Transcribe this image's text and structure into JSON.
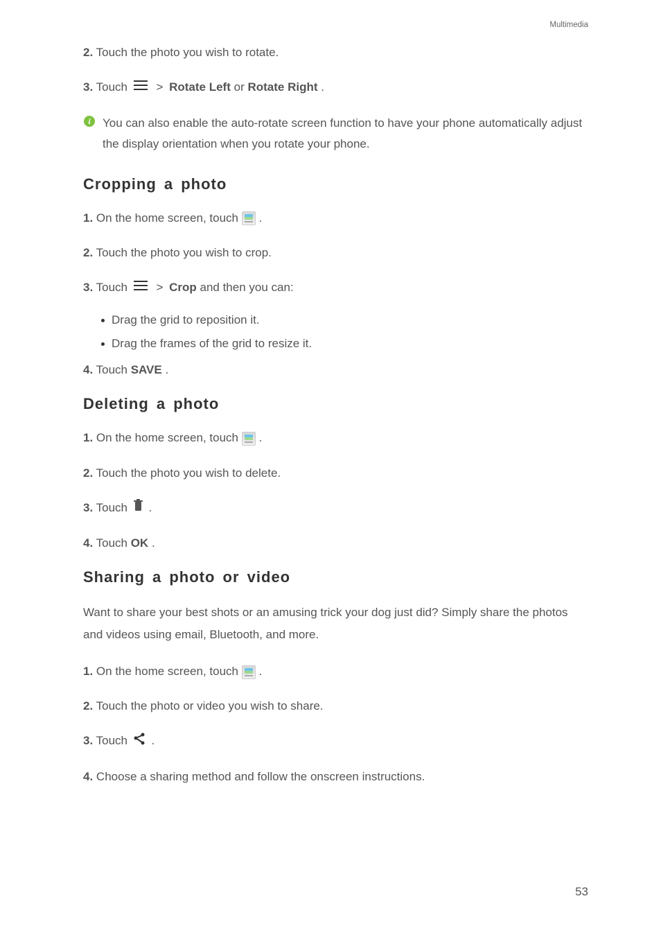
{
  "header": "Multimedia",
  "intro_steps": {
    "step2": {
      "num": "2.",
      "text": "Touch the photo you wish to rotate."
    },
    "step3": {
      "num": "3.",
      "prefix": "Touch ",
      "gt": " > ",
      "opt1": "Rotate Left",
      "or": " or ",
      "opt2": "Rotate Right",
      "period": "."
    }
  },
  "note": "You can also enable the auto-rotate screen function to have your phone automatically adjust the display orientation when you rotate your phone.",
  "cropping": {
    "heading": "Cropping a photo",
    "step1": {
      "num": "1.",
      "prefix": "On the home screen, touch ",
      "suffix": "."
    },
    "step2": {
      "num": "2.",
      "text": "Touch the photo you wish to crop."
    },
    "step3": {
      "num": "3.",
      "prefix": "Touch ",
      "gt": " > ",
      "crop": "Crop",
      "suffix": " and then you can:"
    },
    "bullet1": "Drag the grid to reposition it.",
    "bullet2": "Drag the frames of the grid to resize it.",
    "step4": {
      "num": "4.",
      "prefix": "Touch ",
      "save": "SAVE",
      "period": "."
    }
  },
  "deleting": {
    "heading": "Deleting a photo",
    "step1": {
      "num": "1.",
      "prefix": "On the home screen, touch ",
      "suffix": "."
    },
    "step2": {
      "num": "2.",
      "text": "Touch the photo you wish to delete."
    },
    "step3": {
      "num": "3.",
      "prefix": "Touch ",
      "suffix": "."
    },
    "step4": {
      "num": "4.",
      "prefix": "Touch ",
      "ok": "OK",
      "period": "."
    }
  },
  "sharing": {
    "heading": "Sharing a photo or video",
    "intro": "Want to share your best shots or an amusing trick your dog just did? Simply share the photos and videos using email, Bluetooth, and more.",
    "step1": {
      "num": "1.",
      "prefix": "On the home screen, touch ",
      "suffix": "."
    },
    "step2": {
      "num": "2.",
      "text": "Touch the photo or video you wish to share."
    },
    "step3": {
      "num": "3.",
      "prefix": "Touch ",
      "suffix": "."
    },
    "step4": {
      "num": "4.",
      "text": "Choose a sharing method and follow the onscreen instructions."
    }
  },
  "page_number": "53"
}
